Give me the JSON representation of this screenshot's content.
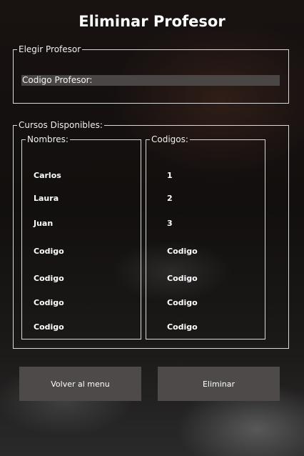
{
  "window": {
    "title": "Eliminar Profesor"
  },
  "elegir": {
    "legend": "Elegir Profesor",
    "input_value": "Codigo Profesor:"
  },
  "cursos": {
    "legend": "Cursos Disponibles:",
    "nombres_legend": "Nombres:",
    "codigos_legend": "Codigos:",
    "rows": [
      {
        "nombre": "Carlos",
        "codigo": "1"
      },
      {
        "nombre": "Laura",
        "codigo": "2"
      },
      {
        "nombre": "Juan",
        "codigo": "3"
      },
      {
        "nombre": "Codigo",
        "codigo": "Codigo"
      },
      {
        "nombre": "Codigo",
        "codigo": "Codigo"
      },
      {
        "nombre": "Codigo",
        "codigo": "Codigo"
      },
      {
        "nombre": "Codigo",
        "codigo": "Codigo"
      }
    ]
  },
  "buttons": {
    "volver": "Volver al menu",
    "eliminar": "Eliminar"
  }
}
